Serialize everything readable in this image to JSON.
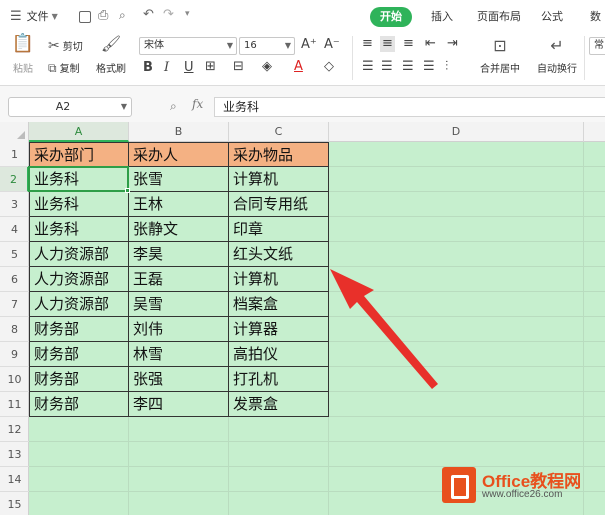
{
  "menubar": {
    "file_label": "文件",
    "tabs": [
      {
        "label": "开始",
        "active": true
      },
      {
        "label": "插入",
        "active": false
      },
      {
        "label": "页面布局",
        "active": false
      },
      {
        "label": "公式",
        "active": false
      },
      {
        "label": "数",
        "active": false
      }
    ]
  },
  "ribbon": {
    "paste_label": "粘贴",
    "cut_label": "剪切",
    "copy_label": "复制",
    "format_painter_label": "格式刷",
    "font_name": "宋体",
    "font_size": "16",
    "bold_label": "B",
    "italic_label": "I",
    "underline_label": "U",
    "merge_label": "合并居中",
    "wrap_label": "自动换行",
    "general_label": "常"
  },
  "formula_bar": {
    "cell_ref": "A2",
    "fx_label": "fx",
    "value": "业务科"
  },
  "sheet": {
    "columns": [
      "A",
      "B",
      "C",
      "D"
    ],
    "rows": [
      "1",
      "2",
      "3",
      "4",
      "5",
      "6",
      "7",
      "8",
      "9",
      "10",
      "11",
      "12",
      "13",
      "14",
      "15"
    ],
    "header": [
      "采办部门",
      "采办人",
      "采办物品"
    ],
    "data": [
      [
        "业务科",
        "张雪",
        "计算机"
      ],
      [
        "业务科",
        "王林",
        "合同专用纸"
      ],
      [
        "业务科",
        "张静文",
        "印章"
      ],
      [
        "人力资源部",
        "李昊",
        "红头文纸"
      ],
      [
        "人力资源部",
        "王磊",
        "计算机"
      ],
      [
        "人力资源部",
        "吴雪",
        "档案盒"
      ],
      [
        "财务部",
        "刘伟",
        "计算器"
      ],
      [
        "财务部",
        "林雪",
        "高拍仪"
      ],
      [
        "财务部",
        "张强",
        "打孔机"
      ],
      [
        "财务部",
        "李四",
        "发票盒"
      ]
    ],
    "selected_cell": "A2"
  },
  "colors": {
    "accent": "#2fb35a",
    "header_fill": "#f4b183",
    "sheet_fill": "#c6efce",
    "arrow": "#e8302a"
  },
  "watermark": {
    "title": "Office教程网",
    "url": "www.office26.com"
  }
}
